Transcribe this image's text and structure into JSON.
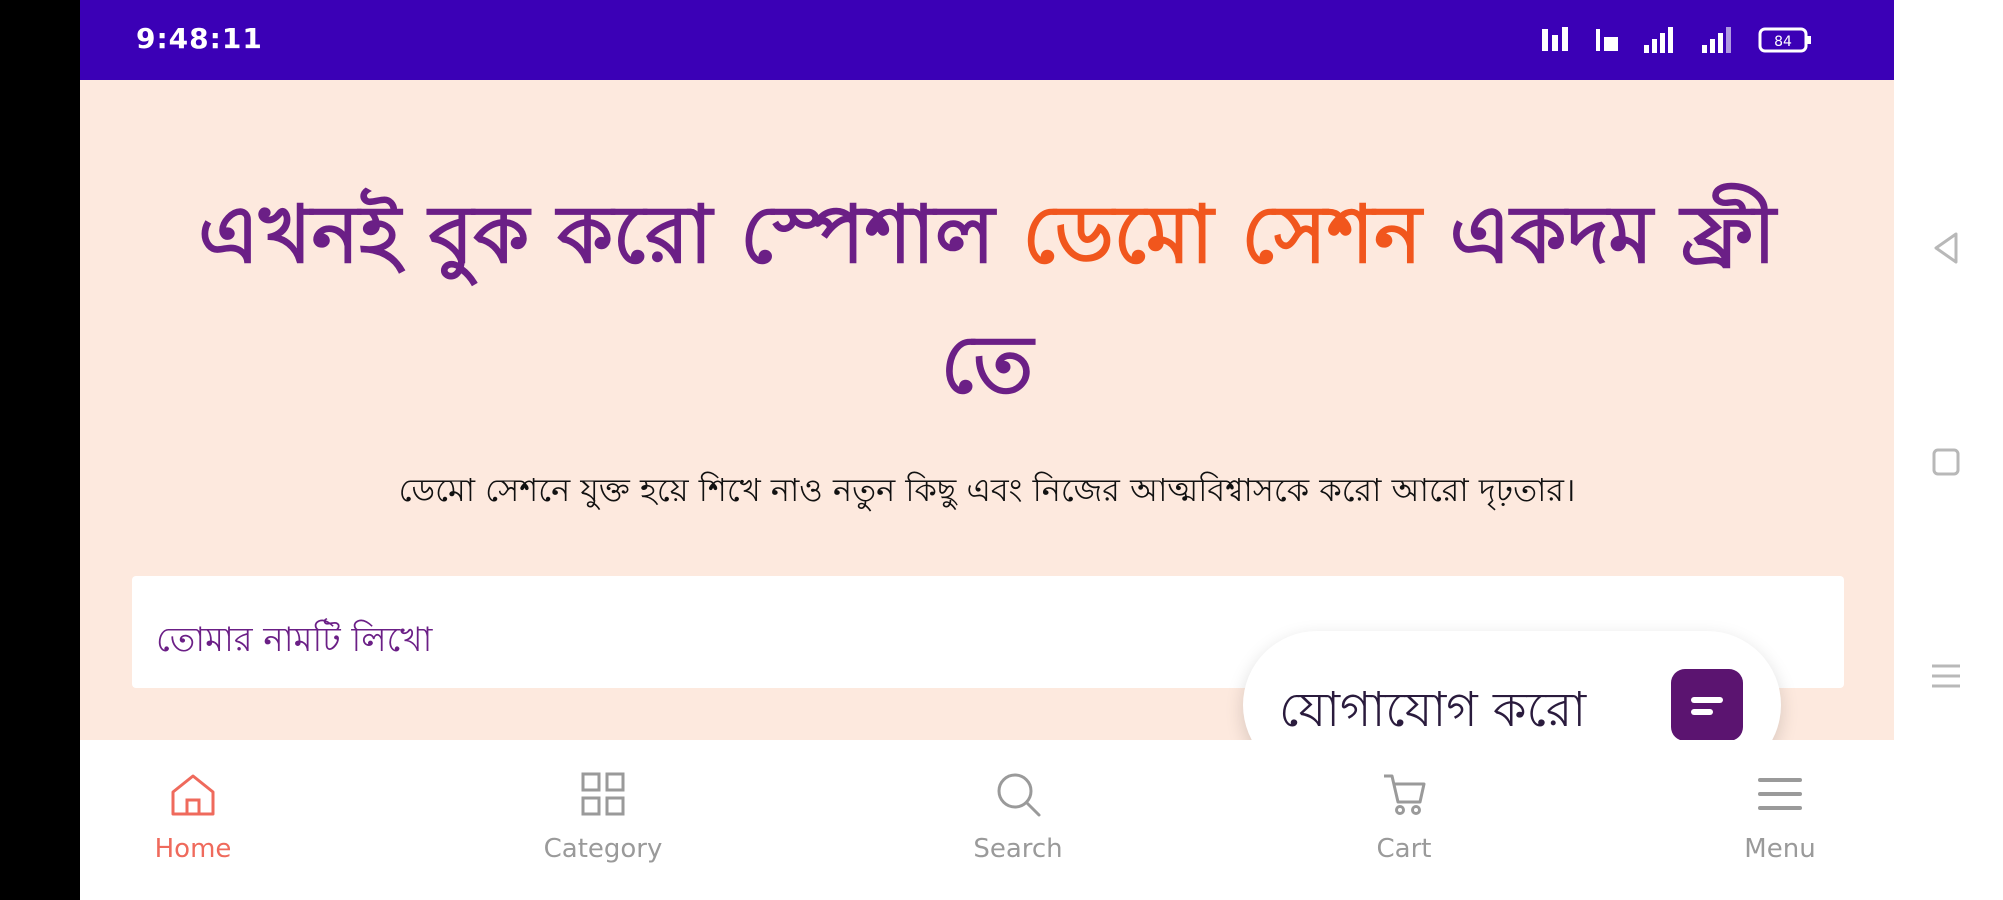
{
  "status_bar": {
    "time": "9:48:11",
    "battery": "84",
    "icons": [
      "data-speed-icon",
      "volte-icon",
      "signal-icon",
      "signal-icon-2",
      "battery-icon"
    ],
    "background": "#3b00b6"
  },
  "hero": {
    "title_part1": "এখনই বুক করো স্পেশাল ",
    "title_accent": "ডেমো সেশন",
    "title_part2": " একদম ফ্রী তে",
    "subtitle": "ডেমো সেশনে যুক্ত হয়ে শিখে নাও নতুন কিছু এবং নিজের আত্মবিশ্বাসকে করো আরো দৃঢ়তার।",
    "background": "#fde9de",
    "title_color": "#6b1f86",
    "accent_color": "#f1561d"
  },
  "form": {
    "name_placeholder": "তোমার নামটি লিখো"
  },
  "contact_button": {
    "label": "যোগাযোগ করো",
    "icon": "chat-icon"
  },
  "bottom_nav": {
    "items": [
      {
        "label": "Home",
        "icon": "home-icon",
        "active": true
      },
      {
        "label": "Category",
        "icon": "grid-icon",
        "active": false
      },
      {
        "label": "Search",
        "icon": "search-icon",
        "active": false
      },
      {
        "label": "Cart",
        "icon": "cart-icon",
        "active": false
      },
      {
        "label": "Menu",
        "icon": "menu-icon",
        "active": false
      }
    ],
    "active_color": "#ef6a5c",
    "inactive_color": "#9a9a9a"
  },
  "system_nav": {
    "buttons": [
      "back-icon",
      "home-square-icon",
      "recents-icon"
    ]
  }
}
